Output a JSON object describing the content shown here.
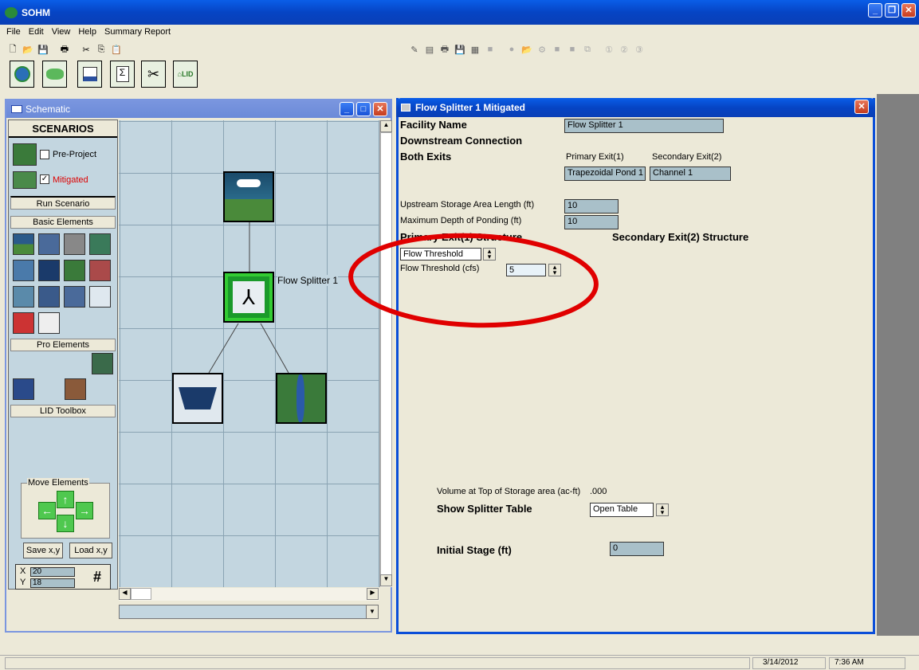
{
  "app": {
    "title": "SOHM",
    "menu": [
      "File",
      "Edit",
      "View",
      "Help",
      "Summary Report"
    ]
  },
  "main_buttons": [
    "globe",
    "land-use",
    "graph",
    "report",
    "tools",
    "lid"
  ],
  "schematic": {
    "title": "Schematic",
    "scenarios_title": "SCENARIOS",
    "pre_project": "Pre-Project",
    "mitigated": "Mitigated",
    "run_scenario": "Run Scenario",
    "basic_elements": "Basic Elements",
    "pro_elements": "Pro Elements",
    "lid_toolbox": "LID Toolbox",
    "move_elements": "Move Elements",
    "save_xy": "Save x,y",
    "load_xy": "Load x,y",
    "x_label": "X",
    "x_value": "20",
    "y_label": "Y",
    "y_value": "18",
    "grid_symbol": "#",
    "node_label": "Flow Splitter  1"
  },
  "dialog": {
    "title": "Flow Splitter  1 Mitigated",
    "facility_name_label": "Facility Name",
    "facility_name": "Flow Splitter  1",
    "downstream_label": "Downstream Connection",
    "both_exits_label": "Both Exits",
    "primary_exit_label": "Primary Exit(1)",
    "secondary_exit_label": "Secondary Exit(2)",
    "primary_exit_value": "Trapezoidal Pond  1",
    "secondary_exit_value": "Channel  1",
    "upstream_length_label": "Upstream Storage Area Length (ft)",
    "upstream_length_value": "10",
    "max_depth_label": "Maximum Depth of Ponding (ft)",
    "max_depth_value": "10",
    "primary_structure_label": "Primary Exit(1) Structure",
    "secondary_structure_label": "Secondary Exit(2) Structure",
    "structure_type": "Flow Threshold",
    "flow_threshold_label": "Flow Threshold (cfs)",
    "flow_threshold_value": "5",
    "volume_label": "Volume at Top of Storage area (ac-ft)",
    "volume_value": ".000",
    "splitter_table_label": "Show Splitter Table",
    "splitter_table_value": "Open Table",
    "initial_stage_label": "Initial Stage (ft)",
    "initial_stage_value": "0"
  },
  "status": {
    "date": "3/14/2012",
    "time": "7:36 AM"
  },
  "colors": {
    "title_bar": "#0a5ee8",
    "annotation": "#e00000",
    "grid": "#c3d6e0"
  }
}
